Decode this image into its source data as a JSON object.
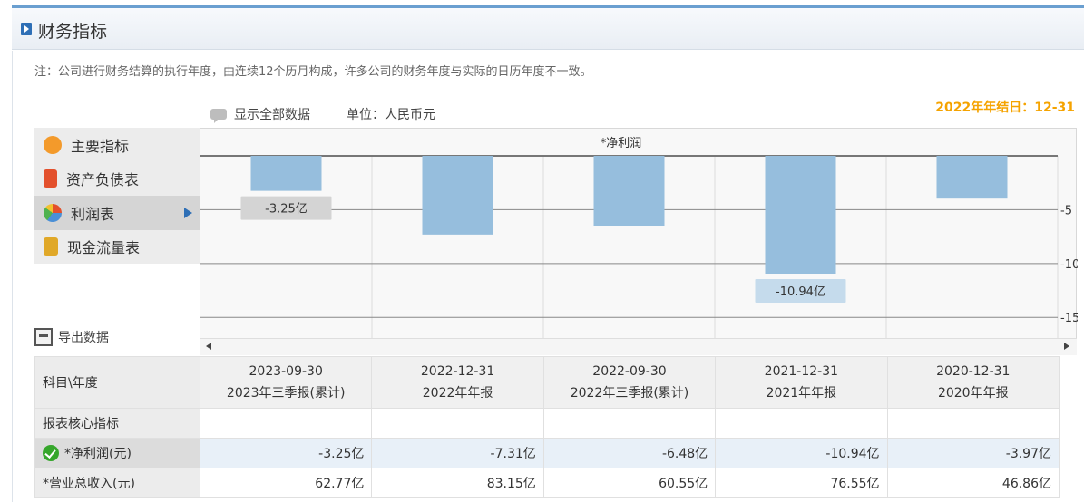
{
  "header": {
    "title": "财务指标"
  },
  "note": "注：公司进行财务结算的执行年度，由连续12个历月构成，许多公司的财务年度与实际的日历年度不一致。",
  "year_end": "2022年年结日：12-31",
  "toolbar": {
    "show_all": "显示全部数据",
    "unit": "单位：人民币元"
  },
  "sidebar": {
    "items": [
      {
        "label": "主要指标",
        "icon": "gear-icon",
        "color": "#f39a2b"
      },
      {
        "label": "资产负债表",
        "icon": "document-icon",
        "color": "#e3502c"
      },
      {
        "label": "利润表",
        "icon": "pie-chart-icon",
        "color": "#4a8fd6"
      },
      {
        "label": "现金流量表",
        "icon": "coins-icon",
        "color": "#e0a828"
      }
    ]
  },
  "export_label": "导出数据",
  "chart_data": {
    "type": "bar",
    "title": "*净利润",
    "categories": [
      "2023-09-30",
      "2022-12-31",
      "2022-09-30",
      "2021-12-31",
      "2020-12-31"
    ],
    "values": [
      -3.25,
      -7.31,
      -6.48,
      -10.94,
      -3.97
    ],
    "ylim": [
      -17,
      0
    ],
    "yticks": [
      "-5",
      "-10",
      "-15"
    ],
    "tooltips": [
      {
        "index": 0,
        "text": "-3.25亿"
      },
      {
        "index": 3,
        "text": "-10.94亿"
      }
    ],
    "bar_color": "#96bedd",
    "grid": true
  },
  "table": {
    "corner": "科目\\年度",
    "columns": [
      {
        "date": "2023-09-30",
        "period": "2023年三季报(累计)"
      },
      {
        "date": "2022-12-31",
        "period": "2022年年报"
      },
      {
        "date": "2022-09-30",
        "period": "2022年三季报(累计)"
      },
      {
        "date": "2021-12-31",
        "period": "2021年年报"
      },
      {
        "date": "2020-12-31",
        "period": "2020年年报"
      }
    ],
    "section": "报表核心指标",
    "rows": [
      {
        "label": "*净利润(元)",
        "values": [
          "-3.25亿",
          "-7.31亿",
          "-6.48亿",
          "-10.94亿",
          "-3.97亿"
        ]
      },
      {
        "label": "*营业总收入(元)",
        "values": [
          "62.77亿",
          "83.15亿",
          "60.55亿",
          "76.55亿",
          "46.86亿"
        ]
      }
    ]
  }
}
